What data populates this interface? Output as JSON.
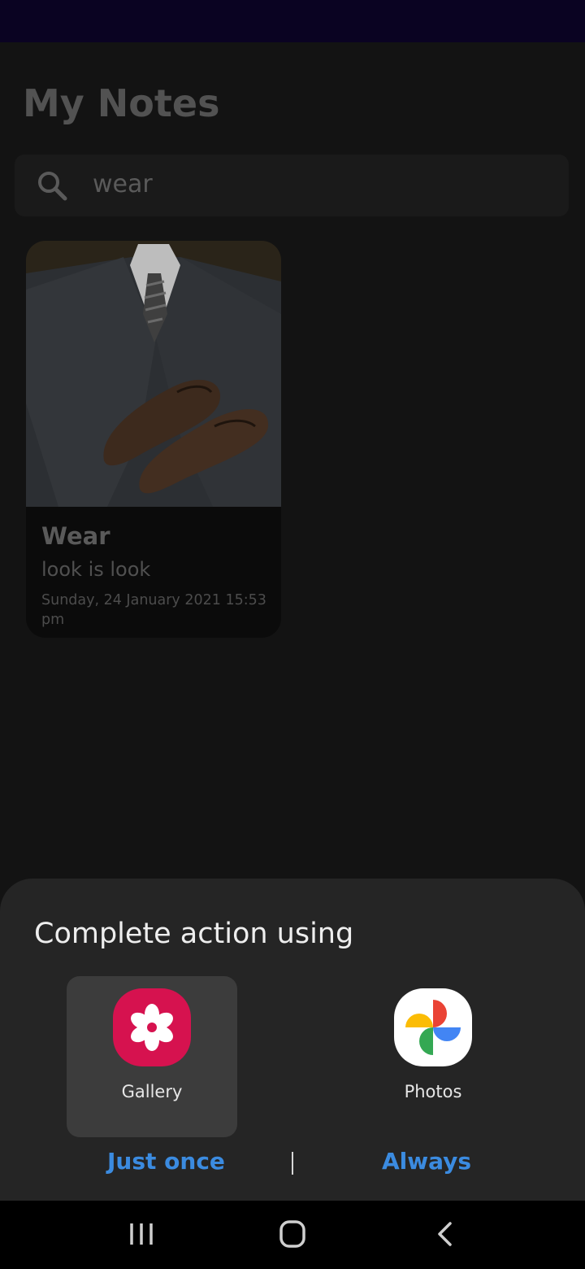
{
  "app": {
    "title": "My Notes",
    "search": {
      "value": "wear",
      "icon": "search-icon"
    },
    "notes": [
      {
        "title": "Wear",
        "subtitle": "look is look",
        "date": "Sunday, 24 January 2021 15:53 pm",
        "image": "suit-and-shoes-photo"
      }
    ]
  },
  "chooser": {
    "title": "Complete action using",
    "apps": [
      {
        "label": "Gallery",
        "icon": "gallery-icon",
        "selected": true
      },
      {
        "label": "Photos",
        "icon": "google-photos-icon",
        "selected": false
      }
    ],
    "just_once_label": "Just once",
    "always_label": "Always"
  },
  "nav": {
    "recents": "recents-icon",
    "home": "home-icon",
    "back": "back-icon"
  },
  "colors": {
    "status_bar": "#0a0322",
    "sheet_bg": "#252525",
    "accent": "#3b8be0",
    "gallery_icon": "#d6124f"
  }
}
